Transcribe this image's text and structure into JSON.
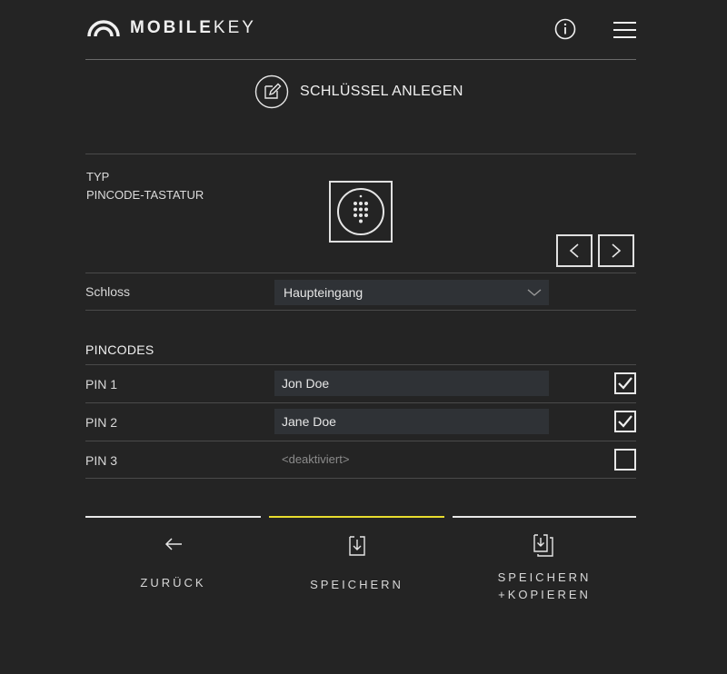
{
  "header": {
    "logo_bold": "MOBILE",
    "logo_light": "KEY",
    "info_icon": "info-icon",
    "menu_icon": "hamburger-menu-icon"
  },
  "page": {
    "title": "SCHLÜSSEL ANLEGEN",
    "title_icon": "edit-icon"
  },
  "type": {
    "label": "TYP",
    "value": "PINCODE-TASTATUR",
    "icon": "keypad-icon",
    "prev_icon": "chevron-left-icon",
    "next_icon": "chevron-right-icon"
  },
  "lock": {
    "label": "Schloss",
    "selected": "Haupteingang"
  },
  "pincodes": {
    "heading": "PINCODES",
    "rows": [
      {
        "label": "PIN 1",
        "value": "Jon Doe",
        "checked": true
      },
      {
        "label": "PIN 2",
        "value": "Jane Doe",
        "checked": true
      },
      {
        "label": "PIN 3",
        "value": "<deaktiviert>",
        "checked": false
      }
    ]
  },
  "actions": {
    "back_label": "ZURÜCK",
    "save_label": "SPEICHERN",
    "save_copy_line1": "SPEICHERN",
    "save_copy_line2": "+KOPIEREN",
    "active": "save"
  },
  "colors": {
    "background": "#242424",
    "accent": "#e8dc2e",
    "field": "#2f3236"
  }
}
